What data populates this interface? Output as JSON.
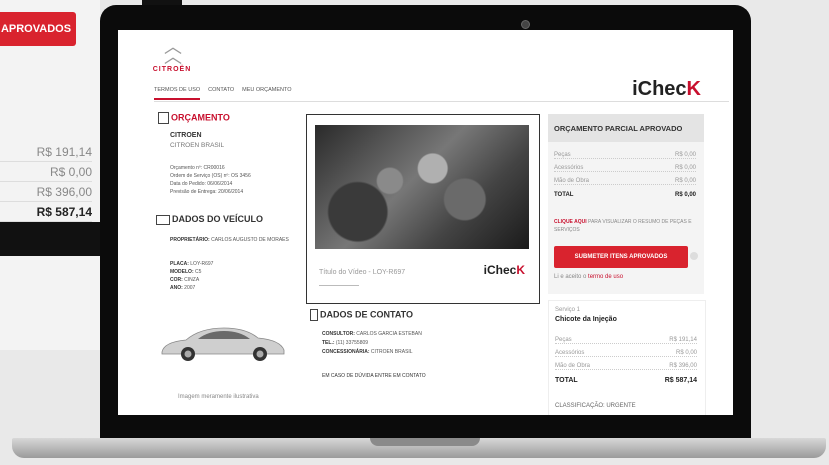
{
  "background": {
    "approve_button": "APROVADOS",
    "values": [
      "R$ 191,14",
      "R$ 0,00",
      "R$ 396,00"
    ],
    "total": "R$ 587,14"
  },
  "header": {
    "logo_text": "CITROËN",
    "nav": [
      "TERMOS DE USO",
      "CONTATO",
      "MEU ORÇAMENTO"
    ],
    "brand": "iChec",
    "brand_k": "K"
  },
  "orcamento": {
    "title": "ORÇAMENTO",
    "company": "CITROEN",
    "company_sub": "CITROEN BRASIL",
    "lines": [
      "Orçamento nº: CR00016",
      "Ordem de Serviço (OS) nº: OS 3456",
      "Data do Pedido: 06/06/2014",
      "Previsão de Entrega: 20/06/2014"
    ]
  },
  "veiculo": {
    "title": "DADOS DO VEÍCULO",
    "lines": [
      {
        "k": "PROPRIETÁRIO:",
        "v": "CARLOS AUGUSTO DE MORAES"
      },
      {
        "k": "PLACA:",
        "v": "LOY-R697"
      },
      {
        "k": "MODELO:",
        "v": "C5"
      },
      {
        "k": "COR:",
        "v": "CINZA"
      },
      {
        "k": "ANO:",
        "v": "2007"
      }
    ],
    "caption": "Imagem meramente ilustrativa"
  },
  "video": {
    "title": "Título do Vídeo - LOY-R697",
    "brand": "iChec",
    "brand_k": "K"
  },
  "contato": {
    "title": "DADOS DE CONTATO",
    "lines": [
      {
        "k": "CONSULTOR:",
        "v": "CARLOS GARCIA ESTEBAN"
      },
      {
        "k": "TEL.:",
        "v": "(11) 33755809"
      },
      {
        "k": "CONCESSIONÁRIA:",
        "v": "CITROEN BRASIL"
      }
    ],
    "note": "EM CASO DE DÚVIDA ENTRE EM CONTATO"
  },
  "parcial": {
    "title": "ORÇAMENTO PARCIAL APROVADO",
    "rows": [
      {
        "k": "Peças",
        "v": "R$ 0,00"
      },
      {
        "k": "Acessórios",
        "v": "R$ 0,00"
      },
      {
        "k": "Mão de Obra",
        "v": "R$ 0,00"
      }
    ],
    "total_label": "TOTAL",
    "total_value": "R$ 0,00",
    "note_link": "CLIQUE AQUI",
    "note_text": "PARA VISUALIZAR O RESUMO DE PEÇAS E SERVIÇOS",
    "submit": "SUBMETER ITENS APROVADOS",
    "terms_prefix": "Li e aceito o",
    "terms_link": "termo de uso"
  },
  "servico": {
    "label": "Serviço 1",
    "title": "Chicote da Injeção",
    "rows": [
      {
        "k": "Peças",
        "v": "R$ 191,14"
      },
      {
        "k": "Acessórios",
        "v": "R$ 0,00"
      },
      {
        "k": "Mão de Obra",
        "v": "R$ 396,00"
      }
    ],
    "total_label": "TOTAL",
    "total_value": "R$ 587,14",
    "classificacao": "CLASSIFICAÇÃO: URGENTE"
  }
}
